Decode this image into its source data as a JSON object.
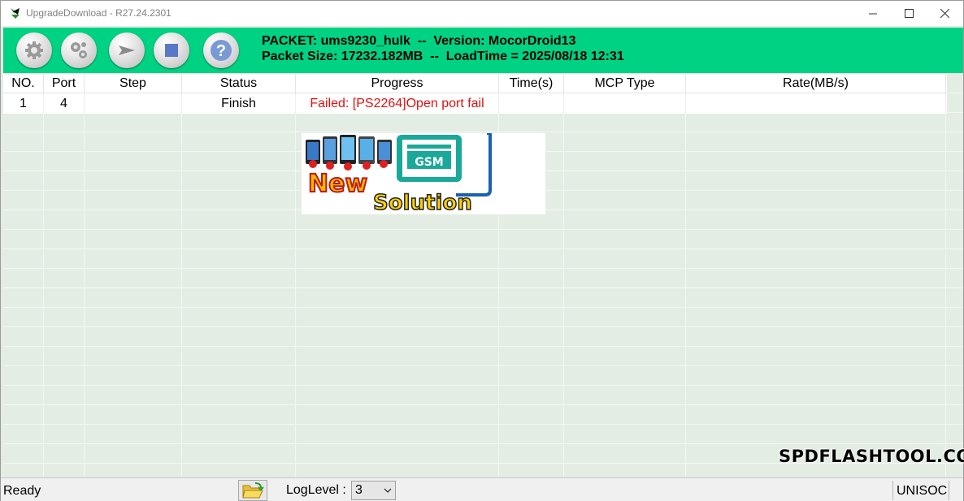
{
  "window": {
    "title": "UpgradeDownload - R27.24.2301",
    "controls": {
      "minimize": "—",
      "maximize": "☐",
      "close": "✕"
    }
  },
  "toolbar": {
    "buttons": [
      {
        "name": "settings-button",
        "icon": "gear-icon"
      },
      {
        "name": "advanced-settings-button",
        "icon": "gears-icon"
      },
      {
        "name": "start-download-button",
        "icon": "play-arrow-icon"
      },
      {
        "name": "stop-download-button",
        "icon": "stop-icon"
      },
      {
        "name": "help-button",
        "icon": "question-icon",
        "label": "?"
      }
    ],
    "packet_line": "PACKET: ums9230_hulk  --  Version: MocorDroid13",
    "size_line": "Packet Size: 17232.182MB  --  LoadTime = 2025/08/18 12:31"
  },
  "table": {
    "columns": [
      "NO.",
      "Port",
      "Step",
      "Status",
      "Progress",
      "Time(s)",
      "MCP Type",
      "Rate(MB/s)"
    ],
    "rows": [
      {
        "no": "1",
        "port": "4",
        "step": "",
        "status": "Finish",
        "progress": "Failed: [PS2264]Open port fail",
        "time": "",
        "mcp_type": "",
        "rate": ""
      }
    ]
  },
  "logo": {
    "top_text": "GSM",
    "word1": "New",
    "word2": "Solution"
  },
  "watermark": "SPDFLASHTOOL.COM",
  "statusbar": {
    "ready": "Ready",
    "loglevel_label": "LogLevel :",
    "loglevel_value": "3",
    "chip": "UNISOC"
  },
  "colors": {
    "toolbar_bg": "#00d283",
    "grid_bg": "#e4ede4",
    "fail_text": "#e01010"
  }
}
